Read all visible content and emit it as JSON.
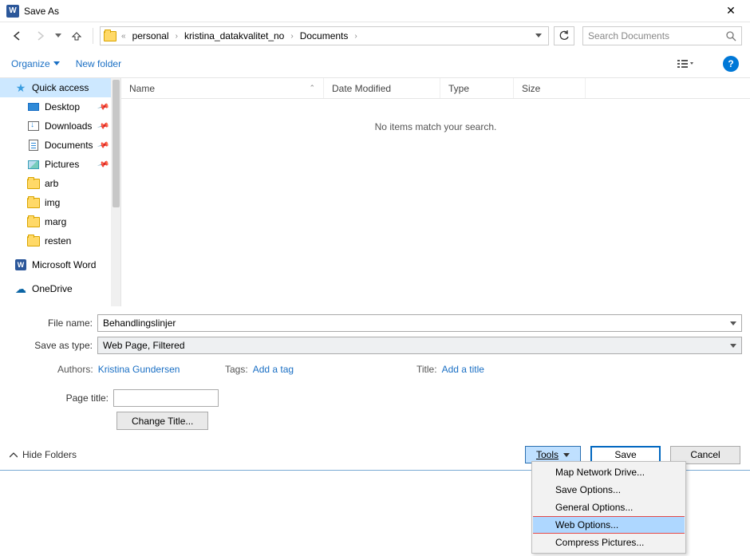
{
  "title": "Save As",
  "breadcrumb": {
    "prefix": "«",
    "parts": [
      "personal",
      "kristina_datakvalitet_no",
      "Documents"
    ]
  },
  "search": {
    "placeholder": "Search Documents"
  },
  "toolbar": {
    "organize": "Organize",
    "newfolder": "New folder"
  },
  "columns": {
    "name": "Name",
    "date": "Date Modified",
    "type": "Type",
    "size": "Size"
  },
  "empty": "No items match your search.",
  "sidebar": {
    "quick": "Quick access",
    "items": [
      {
        "label": "Desktop",
        "pinned": true
      },
      {
        "label": "Downloads",
        "pinned": true
      },
      {
        "label": "Documents",
        "pinned": true
      },
      {
        "label": "Pictures",
        "pinned": true
      },
      {
        "label": "arb",
        "pinned": false
      },
      {
        "label": "img",
        "pinned": false
      },
      {
        "label": "marg",
        "pinned": false
      },
      {
        "label": "resten",
        "pinned": false
      }
    ],
    "word": "Microsoft Word",
    "onedrive": "OneDrive"
  },
  "form": {
    "filename_label": "File name:",
    "filename_value": "Behandlingslinjer",
    "savetype_label": "Save as type:",
    "savetype_value": "Web Page, Filtered",
    "authors_label": "Authors:",
    "authors_value": "Kristina Gundersen",
    "tags_label": "Tags:",
    "tags_value": "Add a tag",
    "title_label": "Title:",
    "title_value": "Add a title",
    "pagetitle_label": "Page title:",
    "change_title": "Change Title..."
  },
  "bottom": {
    "hide": "Hide Folders",
    "tools": "Tools",
    "save": "Save",
    "cancel": "Cancel"
  },
  "menu": {
    "items": [
      "Map Network Drive...",
      "Save Options...",
      "General Options...",
      "Web Options...",
      "Compress Pictures..."
    ],
    "highlighted_index": 3
  }
}
